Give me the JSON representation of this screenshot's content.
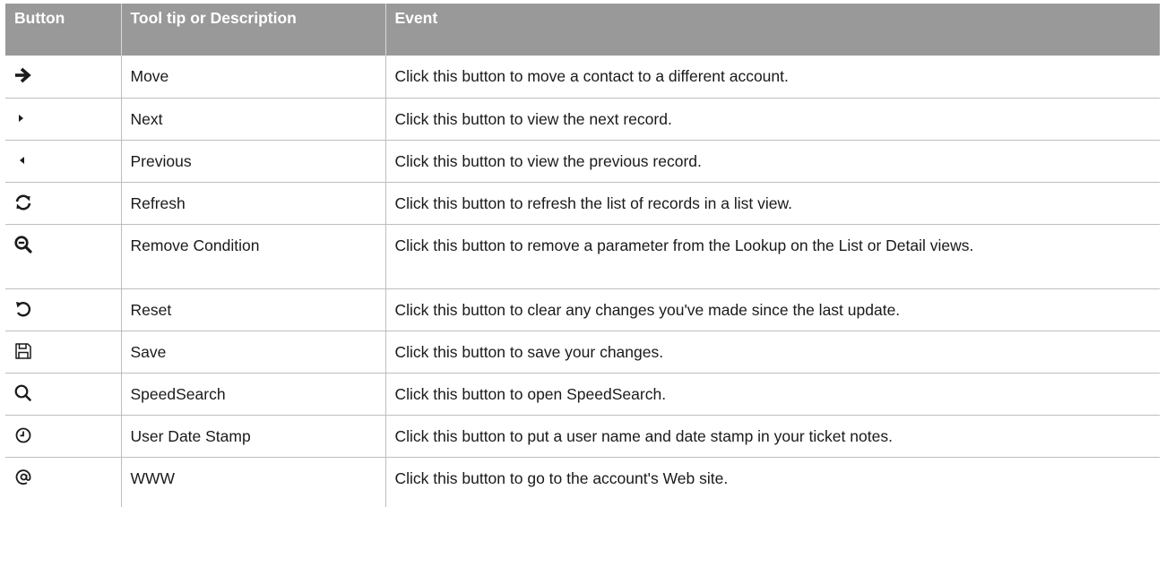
{
  "table": {
    "headers": {
      "button": "Button",
      "tooltip": "Tool tip or Description",
      "event": "Event"
    },
    "rows": [
      {
        "icon": "arrow-right-icon",
        "tooltip": "Move",
        "event": "Click this button to move a contact to a different account."
      },
      {
        "icon": "play-next-icon",
        "tooltip": "Next",
        "event": "Click this button to view the next record."
      },
      {
        "icon": "play-previous-icon",
        "tooltip": "Previous",
        "event": "Click this button to view the previous record."
      },
      {
        "icon": "refresh-icon",
        "tooltip": "Refresh",
        "event": "Click this button to refresh the list of records in a list view."
      },
      {
        "icon": "zoom-out-icon",
        "tooltip": "Remove Condition",
        "event": "Click this button to remove a parameter from the Lookup on the List or Detail views."
      },
      {
        "icon": "reset-icon",
        "tooltip": "Reset",
        "event": "Click this button to clear any changes you've made since the last update."
      },
      {
        "icon": "save-icon",
        "tooltip": "Save",
        "event": "Click this button to save your changes."
      },
      {
        "icon": "search-icon",
        "tooltip": "SpeedSearch",
        "event": "Click this button to open SpeedSearch."
      },
      {
        "icon": "clock-icon",
        "tooltip": "User Date Stamp",
        "event": "Click this button to put a user name and date stamp in your ticket notes."
      },
      {
        "icon": "at-sign-icon",
        "tooltip": "WWW",
        "event": "Click this button to go to the account's Web site."
      }
    ]
  }
}
